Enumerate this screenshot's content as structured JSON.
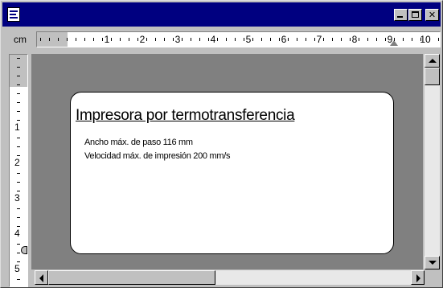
{
  "window": {
    "system_icon": "document-icon",
    "buttons": {
      "minimize_icon": "minimize-icon",
      "maximize_icon": "maximize-icon",
      "close_icon": "close-icon",
      "close_glyph": "✕"
    }
  },
  "ruler": {
    "unit_label": "cm",
    "horizontal_numbers": [
      "1",
      "2",
      "3",
      "4",
      "5",
      "6",
      "7",
      "8",
      "9",
      "10"
    ],
    "vertical_numbers": [
      "1",
      "2",
      "3",
      "4",
      "5"
    ]
  },
  "label": {
    "title": "Impresora por termotransferencia",
    "lines": [
      "Ancho máx. de paso 116 mm",
      "Velocidad máx. de impresión 200 mm/s"
    ]
  },
  "colors": {
    "titlebar": "#000080",
    "face": "#c0c0c0",
    "workspace": "#808080"
  }
}
